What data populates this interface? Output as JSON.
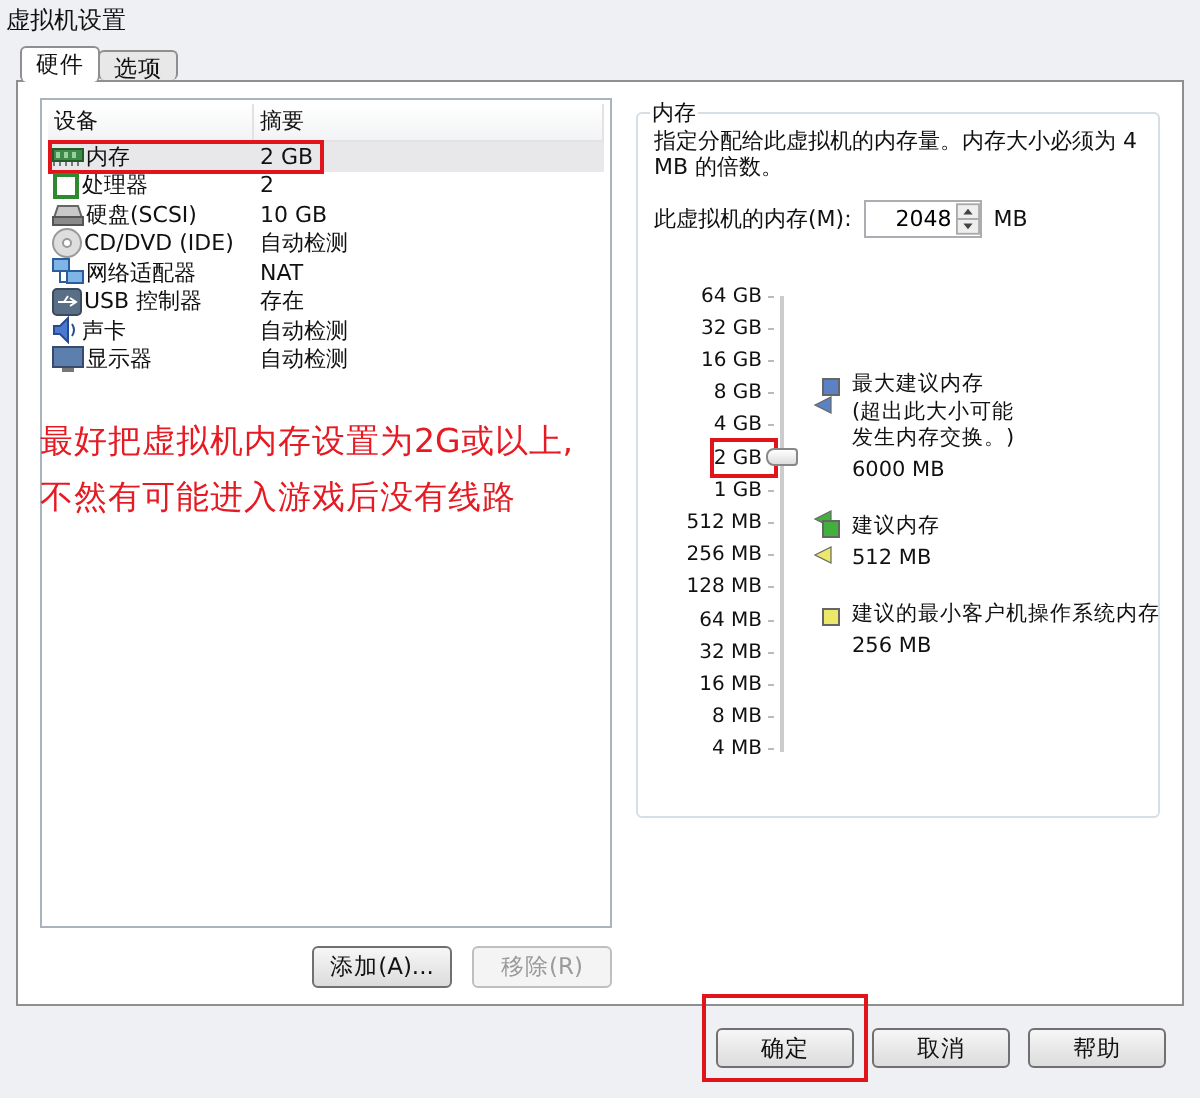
{
  "window": {
    "title": "虚拟机设置"
  },
  "tabs": [
    {
      "label": "硬件",
      "selected": true
    },
    {
      "label": "选项",
      "selected": false
    }
  ],
  "device_table": {
    "columns": [
      "设备",
      "摘要"
    ],
    "rows": [
      {
        "kind": "memory",
        "device": "内存",
        "summary": "2 GB",
        "selected": true,
        "highlighted": true
      },
      {
        "kind": "cpu",
        "device": "处理器",
        "summary": "2",
        "selected": false,
        "highlighted": false
      },
      {
        "kind": "disk",
        "device": "硬盘(SCSI)",
        "summary": "10 GB",
        "selected": false,
        "highlighted": false
      },
      {
        "kind": "cd",
        "device": "CD/DVD (IDE)",
        "summary": "自动检测",
        "selected": false,
        "highlighted": false
      },
      {
        "kind": "network",
        "device": "网络适配器",
        "summary": "NAT",
        "selected": false,
        "highlighted": false
      },
      {
        "kind": "usb",
        "device": "USB 控制器",
        "summary": "存在",
        "selected": false,
        "highlighted": false
      },
      {
        "kind": "sound",
        "device": "声卡",
        "summary": "自动检测",
        "selected": false,
        "highlighted": false
      },
      {
        "kind": "display",
        "device": "显示器",
        "summary": "自动检测",
        "selected": false,
        "highlighted": false
      }
    ]
  },
  "annotation": [
    "最好把虚拟机内存设置为2G或以上,",
    "不然有可能进入游戏后没有线路"
  ],
  "device_buttons": [
    {
      "label": "添加(A)...",
      "disabled": false
    },
    {
      "label": "移除(R)",
      "disabled": true
    }
  ],
  "memory": {
    "title": "内存",
    "description": "指定分配给此虚拟机的内存量。内存大小必须为 4 MB 的倍数。",
    "field_label": "此虚拟机的内存(M):",
    "value": "2048",
    "unit": "MB",
    "scale": [
      {
        "label": "64 GB",
        "highlighted": false
      },
      {
        "label": "32 GB",
        "highlighted": false
      },
      {
        "label": "16 GB",
        "highlighted": false
      },
      {
        "label": "8 GB",
        "highlighted": false
      },
      {
        "label": "4 GB",
        "highlighted": false
      },
      {
        "label": "2 GB",
        "highlighted": true
      },
      {
        "label": "1 GB",
        "highlighted": false
      },
      {
        "label": "512 MB",
        "highlighted": false
      },
      {
        "label": "256 MB",
        "highlighted": false
      },
      {
        "label": "128 MB",
        "highlighted": false
      },
      {
        "label": "64 MB",
        "highlighted": false
      },
      {
        "label": "32 MB",
        "highlighted": false
      },
      {
        "label": "16 MB",
        "highlighted": false
      },
      {
        "label": "8 MB",
        "highlighted": false
      },
      {
        "label": "4 MB",
        "highlighted": false
      }
    ],
    "level": 0.649,
    "markers": [
      {
        "color": "#5b82c4",
        "level": 0.763
      },
      {
        "color": "#44b03c",
        "level": 0.513
      },
      {
        "color": "#ece86a",
        "level": 0.434
      }
    ],
    "legend": [
      {
        "title": "最大建议内存",
        "note": "(超出此大小可能发生内存交换。)",
        "value": "6000 MB",
        "color": "#5b82c4"
      },
      {
        "title": "建议内存",
        "value": "512 MB",
        "color": "#44b03c"
      },
      {
        "title": "建议的最小客户机操作系统内存",
        "value": "256 MB",
        "color": "#ece86a"
      }
    ]
  },
  "buttons": [
    {
      "label": "确定",
      "highlighted": true
    },
    {
      "label": "取消",
      "highlighted": false
    },
    {
      "label": "帮助",
      "highlighted": false
    }
  ]
}
